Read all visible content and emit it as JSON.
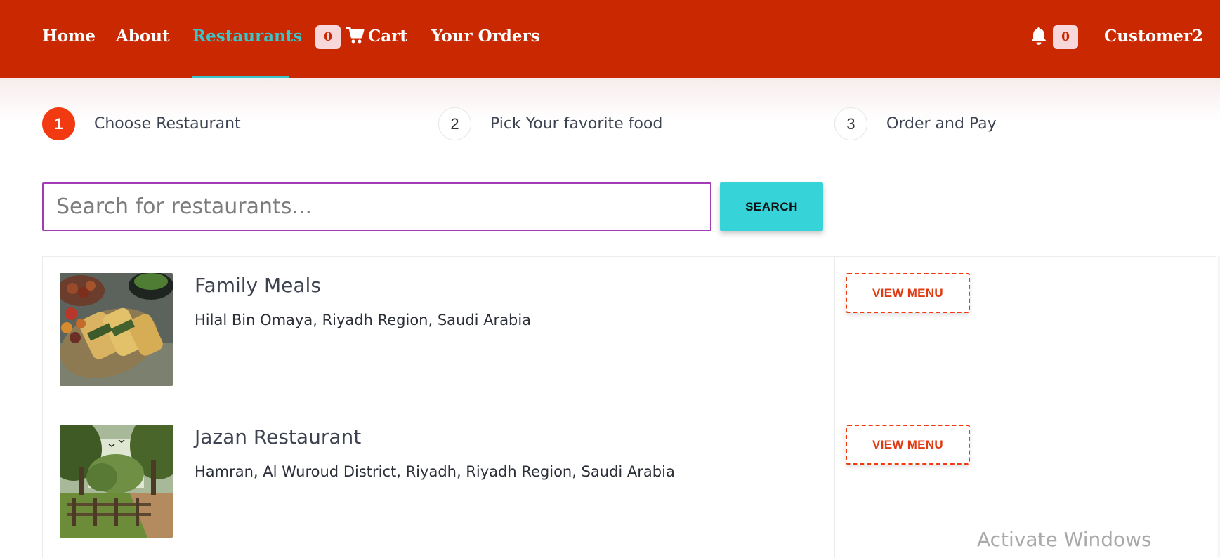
{
  "navbar": {
    "links": [
      {
        "label": "Home",
        "active": false
      },
      {
        "label": "About",
        "active": false
      },
      {
        "label": "Restaurants",
        "active": true
      }
    ],
    "cart": {
      "count": "0",
      "label": "Cart",
      "icon": "cart-icon"
    },
    "orders_label": "Your Orders",
    "notifications": {
      "count": "0",
      "icon": "bell-icon"
    },
    "user_name": "Customer2",
    "colors": {
      "background": "#c92800",
      "active_link": "#3bc5c9",
      "badge_bg": "#f8d7da"
    }
  },
  "stepper": {
    "steps": [
      {
        "number": "1",
        "label": "Choose Restaurant",
        "active": true
      },
      {
        "number": "2",
        "label": "Pick Your favorite food",
        "active": false
      },
      {
        "number": "3",
        "label": "Order and Pay",
        "active": false
      }
    ],
    "active_color": "#f13a12"
  },
  "search": {
    "placeholder": "Search for restaurants...",
    "value": "",
    "button_label": "SEARCH",
    "button_color": "#36d4d9"
  },
  "restaurants": [
    {
      "name": "Family Meals",
      "address": "Hilal Bin Omaya, Riyadh Region, Saudi Arabia",
      "image": "grilled-stuffed-chicken-photo",
      "button_label": "VIEW MENU"
    },
    {
      "name": "Jazan Restaurant",
      "address": "Hamran, Al Wuroud District, Riyadh, Riyadh Region, Saudi Arabia",
      "image": "park-trees-fence-photo",
      "button_label": "VIEW MENU"
    }
  ],
  "watermark": "Activate Windows"
}
